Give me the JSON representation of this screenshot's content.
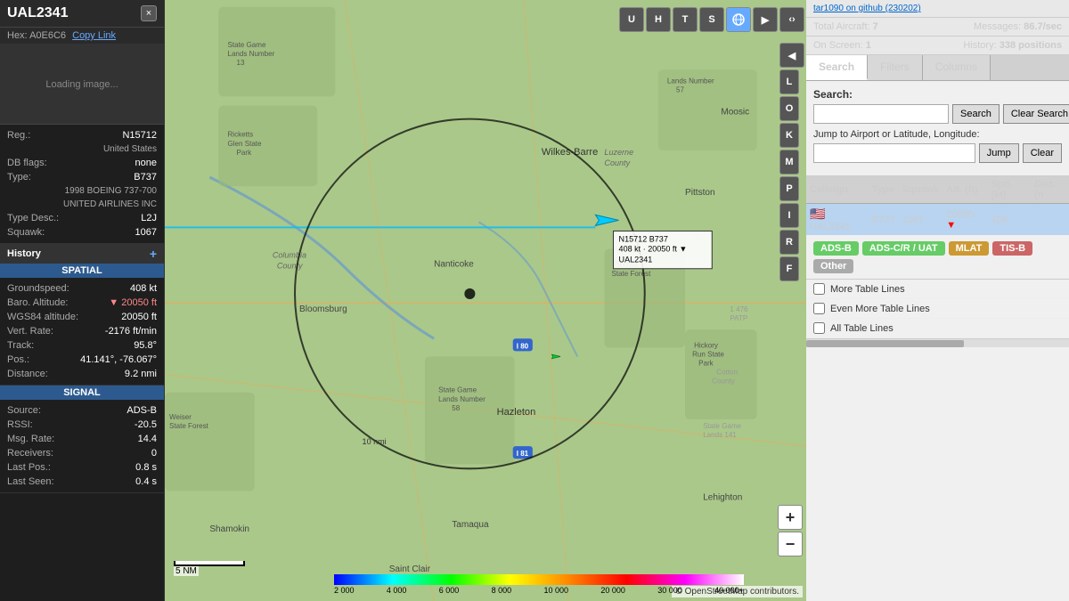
{
  "app": {
    "title": "tar1090 on github (230202)",
    "github_link": "tar1090 on github (230202)"
  },
  "left_panel": {
    "aircraft_id": "UAL2341",
    "hex": "A0E6C6",
    "hex_label": "Hex:",
    "copy_link": "Copy Link",
    "close_btn": "×",
    "image_placeholder": "Loading image...",
    "reg_label": "Reg.:",
    "reg_value": "N15712",
    "country": "United States",
    "db_flags_label": "DB flags:",
    "db_flags_value": "none",
    "type_label": "Type:",
    "type_value": "B737",
    "type_desc": "1998 BOEING 737-700",
    "airline": "UNITED AIRLINES INC",
    "type_desc_label": "Type Desc.:",
    "type_desc_value": "L2J",
    "squawk_label": "Squawk:",
    "squawk_value": "1067",
    "history_label": "History",
    "spatial_label": "SPATIAL",
    "groundspeed_label": "Groundspeed:",
    "groundspeed_value": "408 kt",
    "baro_alt_label": "Baro. Altitude:",
    "baro_alt_value": "▼ 20050 ft",
    "wgs84_label": "WGS84 altitude:",
    "wgs84_value": "20050 ft",
    "vert_rate_label": "Vert. Rate:",
    "vert_rate_value": "-2176 ft/min",
    "track_label": "Track:",
    "track_value": "95.8°",
    "pos_label": "Pos.:",
    "pos_value": "41.141°, -76.067°",
    "distance_label": "Distance:",
    "distance_value": "9.2 nmi",
    "signal_label": "SIGNAL",
    "source_label": "Source:",
    "source_value": "ADS-B",
    "rssi_label": "RSSI:",
    "rssi_value": "-20.5",
    "msg_rate_label": "Msg. Rate:",
    "msg_rate_value": "14.4",
    "receivers_label": "Receivers:",
    "receivers_value": "0",
    "last_pos_label": "Last Pos.:",
    "last_pos_value": "0.8 s",
    "last_seen_label": "Last Seen:",
    "last_seen_value": "0.4 s"
  },
  "map": {
    "tooltip": {
      "line1": "N15712 B737",
      "line2": "408 kt · 20050 ft ▼",
      "line3": "UAL2341"
    },
    "scale_label": "5 NM",
    "attribution": "© OpenStreetMap contributors.",
    "altitude_labels": [
      "2 000",
      "4 000",
      "6 000",
      "8 000",
      "10 000",
      "20 000",
      "30 000",
      "40 000+"
    ]
  },
  "map_buttons": {
    "u_btn": "U",
    "h_btn": "H",
    "t_btn": "T",
    "s_btn": "S",
    "globe_btn": "🌐",
    "arrow_btn": "▶",
    "code_btn": "‹›",
    "l_btn": "L",
    "o_btn": "O",
    "k_btn": "K",
    "m_btn": "M",
    "p_btn": "P",
    "i_btn": "I",
    "r_btn": "R",
    "f_btn": "F",
    "left_arrow": "◀",
    "zoom_in": "+",
    "zoom_out": "−"
  },
  "right_panel": {
    "stats": {
      "total_aircraft_label": "Total Aircraft:",
      "total_aircraft_value": "7",
      "on_screen_label": "On Screen:",
      "on_screen_value": "1",
      "messages_label": "Messages:",
      "messages_value": "86.7/sec",
      "history_label": "History:",
      "history_value": "338 positions"
    },
    "tabs": {
      "search": "Search",
      "filters": "Filters",
      "columns": "Columns"
    },
    "search_section": {
      "label": "Search:",
      "placeholder": "",
      "search_btn": "Search",
      "clear_search_btn": "Clear Search",
      "jump_label": "Jump to Airport or Latitude, Longitude:",
      "jump_placeholder": "",
      "jump_btn": "Jump",
      "clear_btn": "Clear"
    },
    "table": {
      "headers": [
        "Callsign",
        "Type",
        "Squawk",
        "Alt. (ft)",
        "Spd. (kt)",
        "Dist. (n"
      ],
      "rows": [
        {
          "flag": "🇺🇸",
          "callsign": "UAL2341",
          "type": "B737",
          "squawk": "1067",
          "alt": "20050",
          "alt_trend": "▼",
          "spd": "408",
          "dist": "",
          "selected": true
        }
      ]
    },
    "filter_tags": [
      {
        "label": "ADS-B",
        "class": "ads-b"
      },
      {
        "label": "ADS-C/R / UAT",
        "class": "ads-c"
      },
      {
        "label": "MLAT",
        "class": "mlat"
      },
      {
        "label": "TIS-B",
        "class": "tis-b"
      },
      {
        "label": "Other",
        "class": "other"
      }
    ],
    "checkboxes": [
      {
        "label": "More Table Lines",
        "checked": false
      },
      {
        "label": "Even More Table Lines",
        "checked": false
      },
      {
        "label": "All Table Lines",
        "checked": false
      }
    ]
  }
}
